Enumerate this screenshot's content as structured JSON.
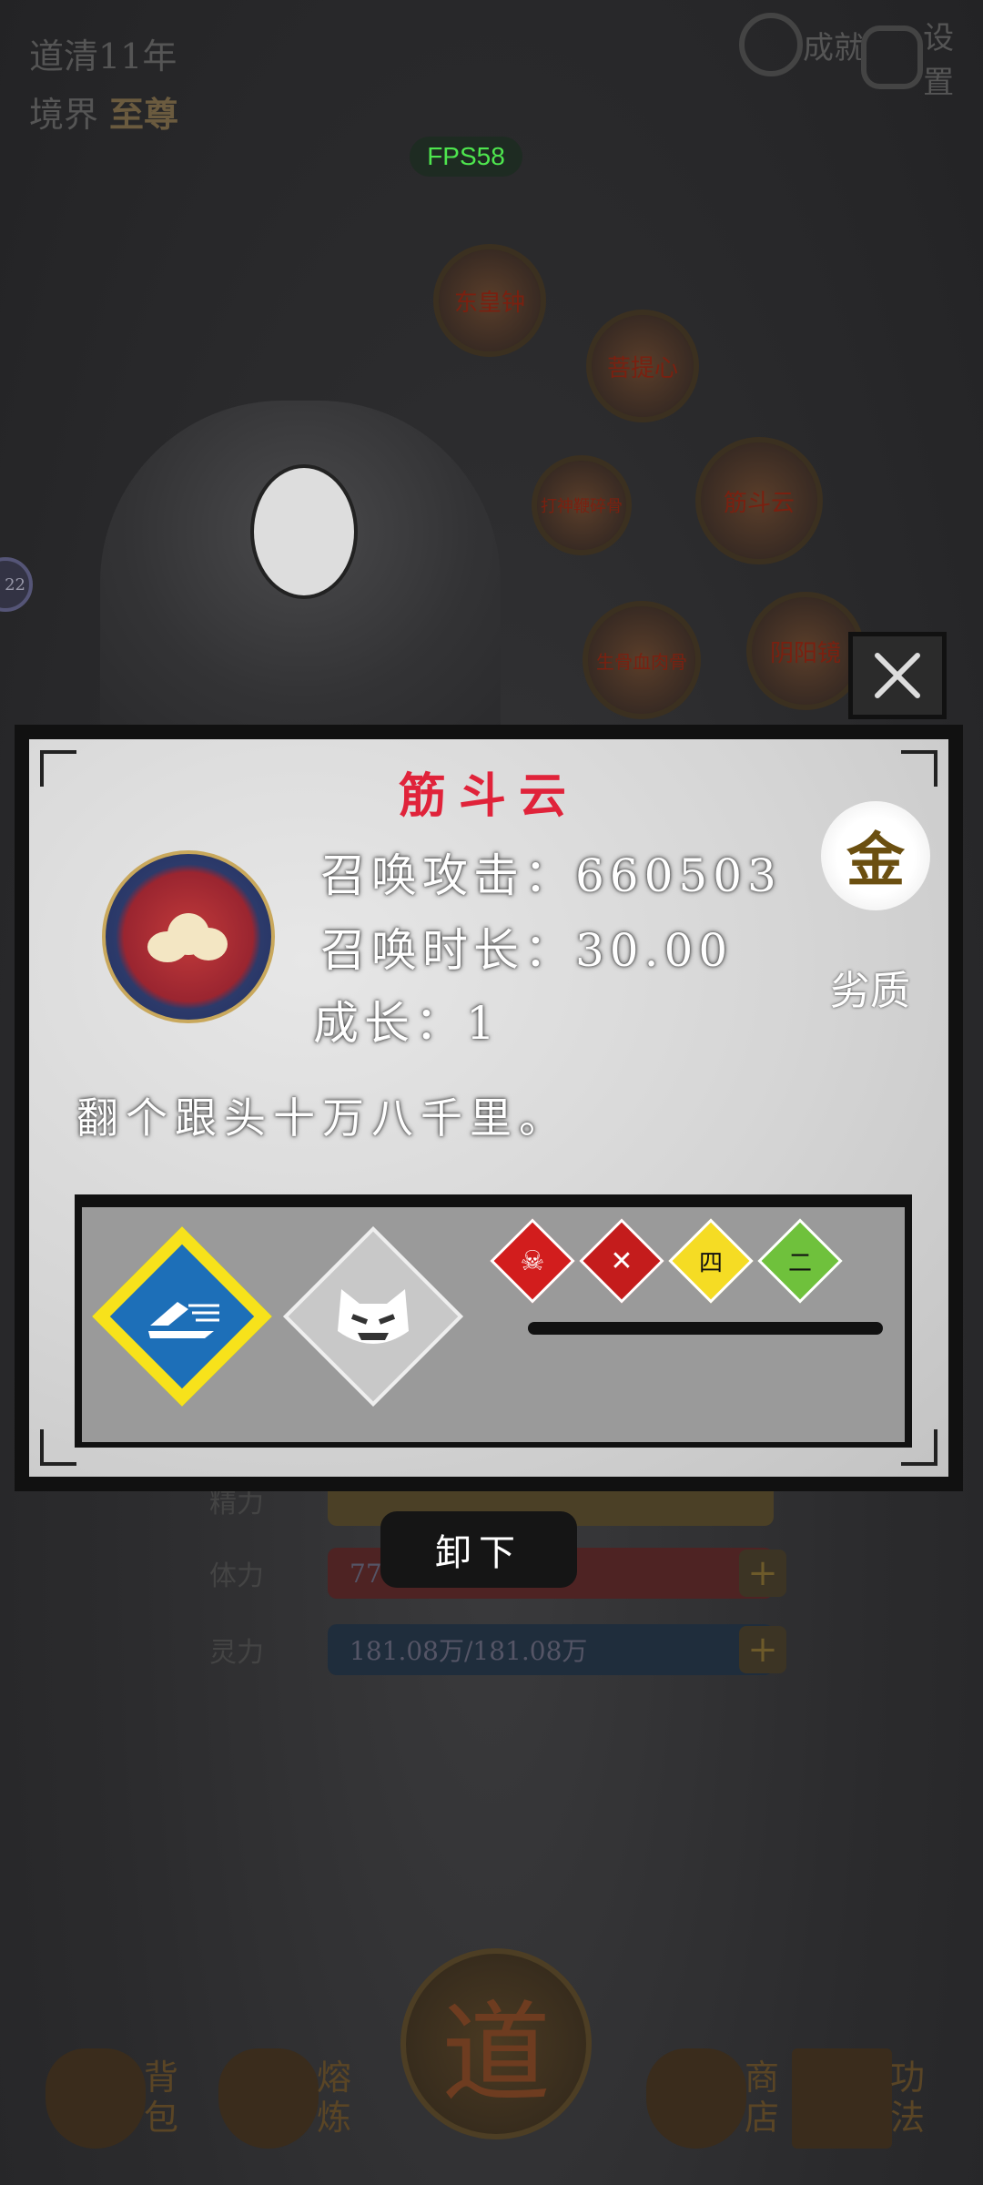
{
  "hud": {
    "daoqing": "道清11年",
    "realm_label": "境界",
    "realm_value": "至尊",
    "achievement_label": "成就",
    "settings_label": "设置",
    "fps": "FPS58",
    "side_badge": "22"
  },
  "equipped_orbs": [
    {
      "name": "东皇钟"
    },
    {
      "name": "菩提心"
    },
    {
      "name": "筋斗云"
    },
    {
      "name": "打神鞭碎骨"
    },
    {
      "name": "生骨血肉骨"
    },
    {
      "name": "阴阳镜"
    }
  ],
  "stats_behind": {
    "row1_label": "精力",
    "hp_label": "体力",
    "hp_value": "776",
    "mp_label": "灵力",
    "mp_value": "181.08万/181.08万"
  },
  "modal": {
    "title": "筋斗云",
    "summon_attack_label": "召唤攻击：",
    "summon_attack_value": "660503",
    "summon_duration_label": "召唤时长：",
    "summon_duration_value": "30.00",
    "growth_label": "成长：",
    "growth_value": "1",
    "quality_char": "金",
    "quality_label": "劣质",
    "description": "翻个跟头十万八千里。",
    "close_icon": "close-icon",
    "effect_icons": [
      "speed-icon",
      "cat-face-icon",
      "skull-cat-icon",
      "crossed-swords-icon",
      "four-icon",
      "two-icon"
    ],
    "unequip_label": "卸下"
  },
  "nav": {
    "bag": "背包",
    "refine": "熔炼",
    "center": "道",
    "shop": "商店",
    "skills": "功法"
  },
  "colors": {
    "title_red": "#e0233a",
    "panel_grey": "#d5d5d5",
    "blue_diamond": "#1d6fb8",
    "yellow_border": "#f7e21b"
  }
}
